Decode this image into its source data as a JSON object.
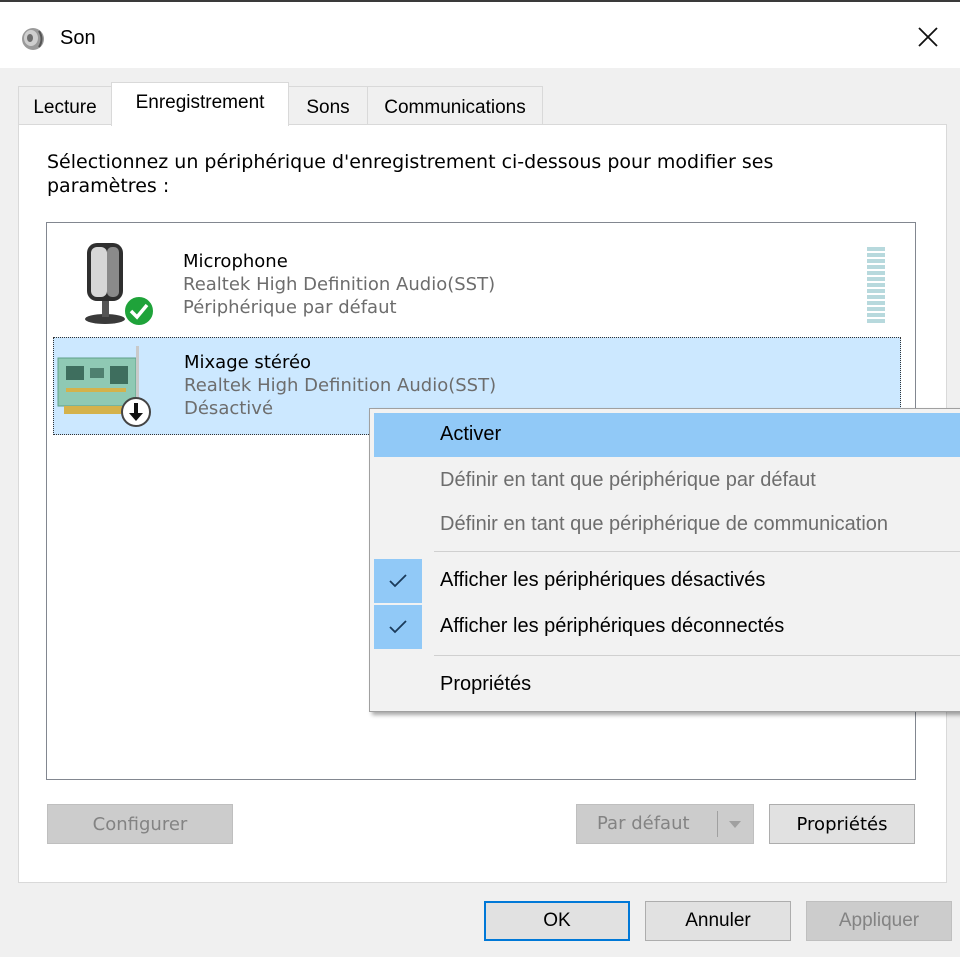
{
  "window": {
    "title": "Son",
    "close_glyph": "✕"
  },
  "tabs": [
    {
      "label": "Lecture",
      "active": false
    },
    {
      "label": "Enregistrement",
      "active": true
    },
    {
      "label": "Sons",
      "active": false
    },
    {
      "label": "Communications",
      "active": false
    }
  ],
  "instructions": "Sélectionnez un périphérique d'enregistrement ci-dessous pour modifier ses paramètres :",
  "devices": [
    {
      "name": "Microphone",
      "driver": "Realtek High Definition Audio(SST)",
      "status": "Périphérique par défaut",
      "icon": "microphone-icon",
      "badge": "default-check-badge",
      "selected": false
    },
    {
      "name": "Mixage stéréo",
      "driver": "Realtek High Definition Audio(SST)",
      "status": "Désactivé",
      "icon": "sound-card-icon",
      "badge": "disabled-arrow-badge",
      "selected": true
    }
  ],
  "buttons": {
    "configure": "Configurer",
    "set_default": "Par défaut",
    "properties": "Propriétés",
    "ok": "OK",
    "cancel": "Annuler",
    "apply": "Appliquer"
  },
  "context_menu": {
    "items": [
      {
        "label": "Activer",
        "enabled": true,
        "highlighted": true
      },
      {
        "label": "Définir en tant que périphérique par défaut",
        "enabled": false
      },
      {
        "label": "Définir en tant que périphérique de communication",
        "enabled": false
      },
      {
        "label": "Afficher les périphériques désactivés",
        "enabled": true,
        "checked": true
      },
      {
        "label": "Afficher les périphériques déconnectés",
        "enabled": true,
        "checked": true
      },
      {
        "label": "Propriétés",
        "enabled": true
      }
    ]
  },
  "colors": {
    "accent": "#0078d7",
    "selection": "#cce8ff",
    "menu_highlight": "#91c9f7",
    "check_badge": "#1fa33a"
  }
}
